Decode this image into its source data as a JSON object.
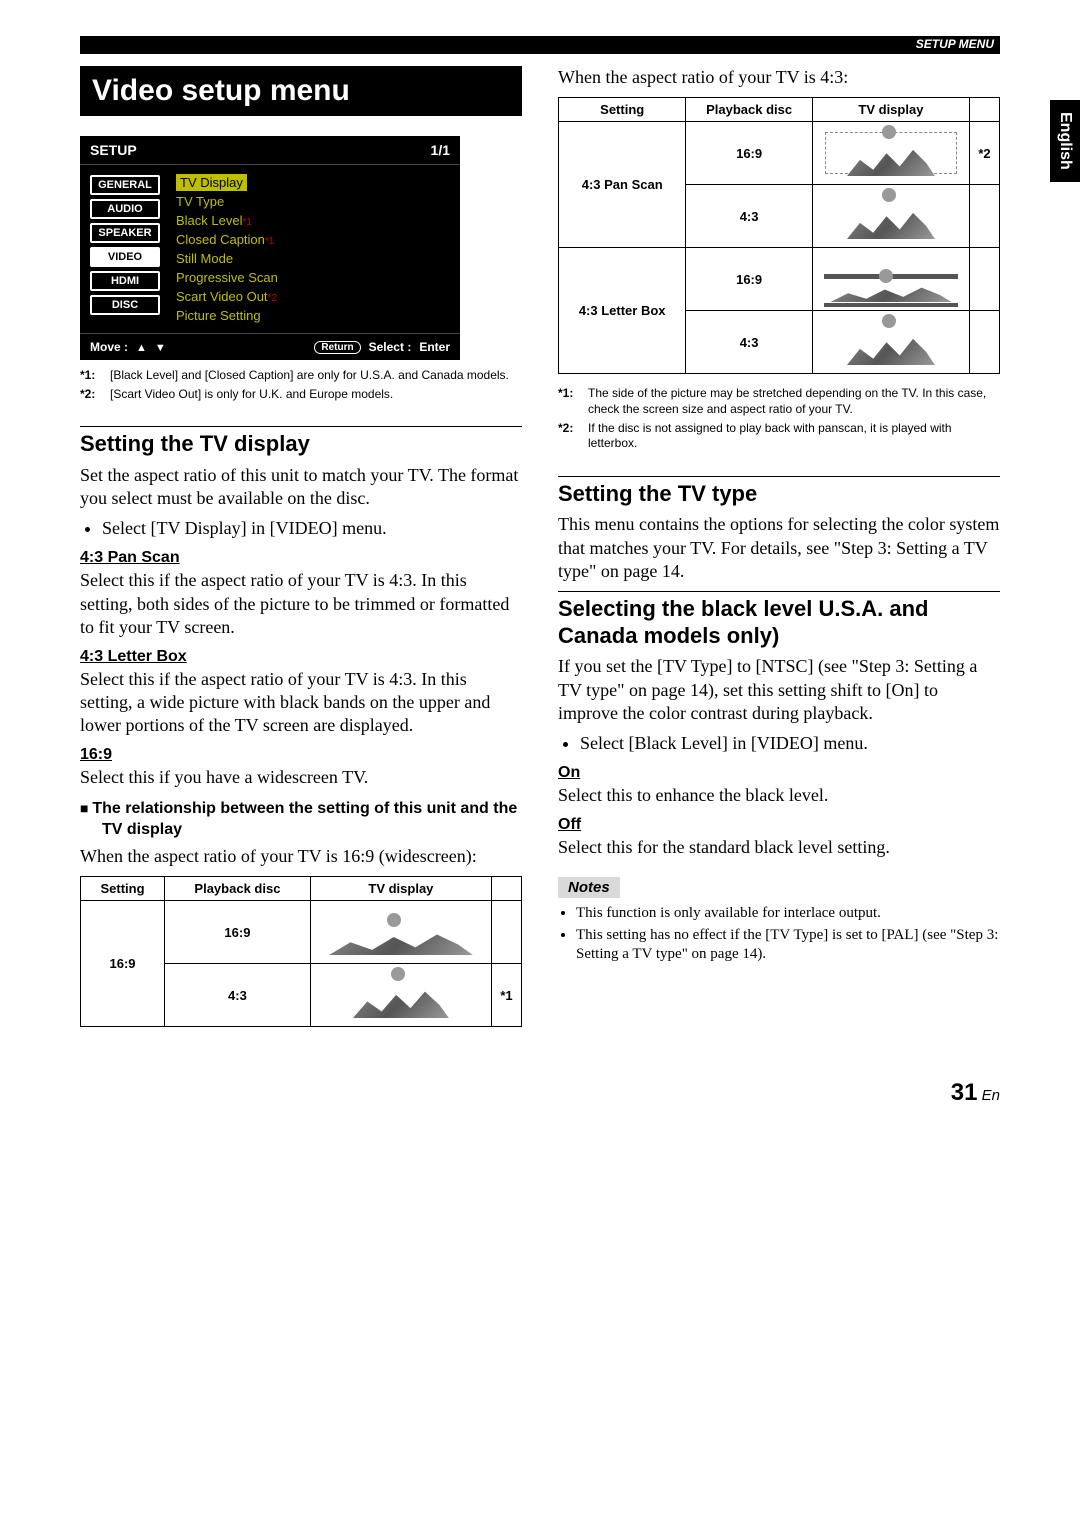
{
  "header": {
    "label": "SETUP MENU"
  },
  "side_tab": "English",
  "title": "Video setup menu",
  "setupbox": {
    "title": "SETUP",
    "page": "1/1",
    "tabs": [
      "GENERAL",
      "AUDIO",
      "SPEAKER",
      "VIDEO",
      "HDMI",
      "DISC"
    ],
    "selected_index": 3,
    "items": [
      {
        "label": "TV Display",
        "highlight": true
      },
      {
        "label": "TV Type"
      },
      {
        "label": "Black Level",
        "note": "*1"
      },
      {
        "label": "Closed Caption",
        "note": "*1"
      },
      {
        "label": "Still Mode"
      },
      {
        "label": "Progressive Scan"
      },
      {
        "label": "Scart Video Out",
        "note": "*2"
      },
      {
        "label": "Picture Setting"
      }
    ],
    "footer": {
      "move": "Move :",
      "return": "Return",
      "select": "Select :",
      "enter": "Enter"
    }
  },
  "setupbox_notes": [
    {
      "key": "*1:",
      "text": "[Black Level] and [Closed Caption] are only for U.S.A. and Canada models."
    },
    {
      "key": "*2:",
      "text": "[Scart Video Out] is only for U.K. and Europe models."
    }
  ],
  "tv_display": {
    "heading": "Setting the TV display",
    "intro": "Set the aspect ratio of this unit to match your TV. The format you select must be available on the disc.",
    "bullet": "Select [TV Display] in [VIDEO] menu.",
    "pan": {
      "h": "4:3 Pan Scan",
      "p": "Select this if the aspect ratio of your TV is 4:3. In this setting, both sides of the picture to be trimmed or formatted to fit your TV screen."
    },
    "lb": {
      "h": "4:3 Letter Box",
      "p": "Select this if the aspect ratio of your TV is 4:3. In this setting, a wide picture with black bands on the upper and lower portions of the TV screen are displayed."
    },
    "ws": {
      "h": "16:9",
      "p": "Select this if you have a widescreen TV."
    },
    "rel_head": "The relationship between the setting of this unit and the TV display",
    "rel_intro": "When the aspect ratio of your TV is 16:9 (widescreen):"
  },
  "table_headers": {
    "setting": "Setting",
    "disc": "Playback disc",
    "tv": "TV display"
  },
  "table1": {
    "setting": "16:9",
    "rows": [
      {
        "disc": "16:9",
        "note": ""
      },
      {
        "disc": "4:3",
        "note": "*1"
      }
    ]
  },
  "col2_intro": "When the aspect ratio of your TV is 4:3:",
  "table2": {
    "rows": [
      {
        "setting": "4:3 Pan Scan",
        "disc": "16:9",
        "note": "*2",
        "dashed": true
      },
      {
        "setting_cont": true,
        "disc": "4:3",
        "note": ""
      },
      {
        "setting": "4:3 Letter Box",
        "disc": "16:9",
        "note": ""
      },
      {
        "setting_cont": true,
        "disc": "4:3",
        "note": ""
      }
    ]
  },
  "table2_notes": [
    {
      "key": "*1:",
      "text": "The side of the picture may be stretched depending on the TV. In this case, check the screen size and aspect ratio of your TV."
    },
    {
      "key": "*2:",
      "text": "If the disc is not assigned to play back with panscan, it is played with letterbox."
    }
  ],
  "tv_type": {
    "heading": "Setting the TV type",
    "p": "This menu contains the options for selecting the color system that matches your TV. For details, see \"Step 3: Setting a TV type\" on page 14."
  },
  "black_level": {
    "heading": "Selecting the black level U.S.A. and Canada models only)",
    "p": "If you set the [TV Type] to [NTSC] (see \"Step 3: Setting a TV type\" on page 14), set this setting shift to [On] to improve the color contrast during playback.",
    "bullet": "Select [Black Level] in [VIDEO] menu.",
    "on": {
      "h": "On",
      "p": "Select this to enhance the black level."
    },
    "off": {
      "h": "Off",
      "p": "Select this for the standard black level setting."
    }
  },
  "notes_label": "Notes",
  "notes_list": [
    "This function is only available for interlace output.",
    "This setting has no effect if the [TV Type] is set to [PAL] (see \"Step 3: Setting a TV type\" on page 14)."
  ],
  "pagenum": {
    "num": "31",
    "suffix": "En"
  }
}
